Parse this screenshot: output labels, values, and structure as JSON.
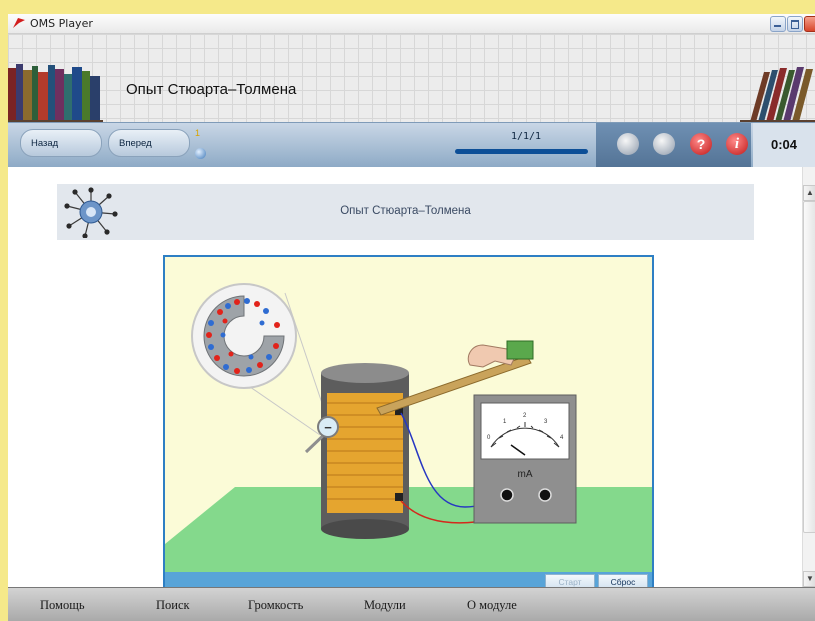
{
  "window": {
    "title": "OMS Player"
  },
  "header": {
    "title": "Опыт Стюарта–Толмена"
  },
  "nav": {
    "back_label": "Назад",
    "forward_label": "Вперед",
    "page_number": "1",
    "progress_label": "1/1/1",
    "timer": "0:04"
  },
  "toolbar": {
    "help_glyph": "?",
    "info_glyph": "i"
  },
  "panel": {
    "title": "Опыт Стюарта–Толмена"
  },
  "simulation": {
    "meter_unit": "mA",
    "meter_ticks": [
      "0",
      "1",
      "2",
      "3",
      "4"
    ],
    "minus_sign": "−",
    "start_label": "Старт",
    "reset_label": "Сброс"
  },
  "menu": {
    "items": [
      "Помощь",
      "Поиск",
      "Громкость",
      "Модули",
      "О модуле"
    ]
  },
  "colors": {
    "nav_blue": "#8eaac6",
    "progress": "#0d4f97",
    "sim_border": "#2e7fc4",
    "sim_background": "#fbfbd7",
    "table_green": "#84d98c",
    "coil": "#e5a52f"
  }
}
